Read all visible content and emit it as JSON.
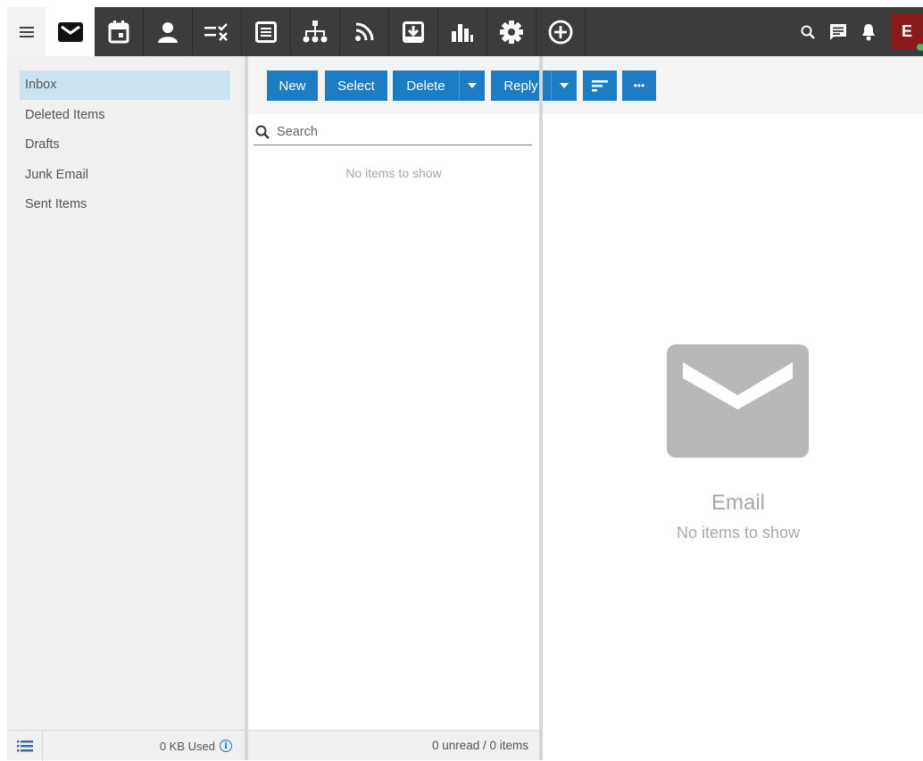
{
  "nav": {
    "tabs": [
      {
        "name": "mail-icon",
        "active": true
      },
      {
        "name": "calendar-icon",
        "active": false
      },
      {
        "name": "contacts-icon",
        "active": false
      },
      {
        "name": "tasks-icon",
        "active": false
      },
      {
        "name": "notes-icon",
        "active": false
      },
      {
        "name": "org-chart-icon",
        "active": false
      },
      {
        "name": "rss-feed-icon",
        "active": false
      },
      {
        "name": "archive-download-icon",
        "active": false
      },
      {
        "name": "reports-chart-icon",
        "active": false
      },
      {
        "name": "settings-gear-icon",
        "active": false
      },
      {
        "name": "add-circle-icon",
        "active": false
      }
    ],
    "right_icons": [
      "search-icon",
      "chat-icon",
      "bell-icon"
    ],
    "avatar_letter": "E",
    "avatar_color": "#8b1a1a",
    "presence_color": "#5cb85c"
  },
  "folders": {
    "items": [
      {
        "label": "Inbox",
        "selected": true
      },
      {
        "label": "Deleted Items",
        "selected": false
      },
      {
        "label": "Drafts",
        "selected": false
      },
      {
        "label": "Junk Email",
        "selected": false
      },
      {
        "label": "Sent Items",
        "selected": false
      }
    ],
    "storage_used": "0 KB Used",
    "info_glyph": "i"
  },
  "toolbar": {
    "new_label": "New",
    "select_label": "Select",
    "delete_label": "Delete",
    "reply_label": "Reply",
    "more_label": "•••",
    "accent_color": "#1d7dc2"
  },
  "list": {
    "search_placeholder": "Search",
    "empty_text": "No items to show",
    "footer_status": "0 unread / 0 items"
  },
  "reading": {
    "title": "Email",
    "subtitle": "No items to show"
  },
  "colors": {
    "topbar": "#3c3c3c",
    "selected_folder": "#cce4f2",
    "pane_bg": "#f0f0f0"
  }
}
